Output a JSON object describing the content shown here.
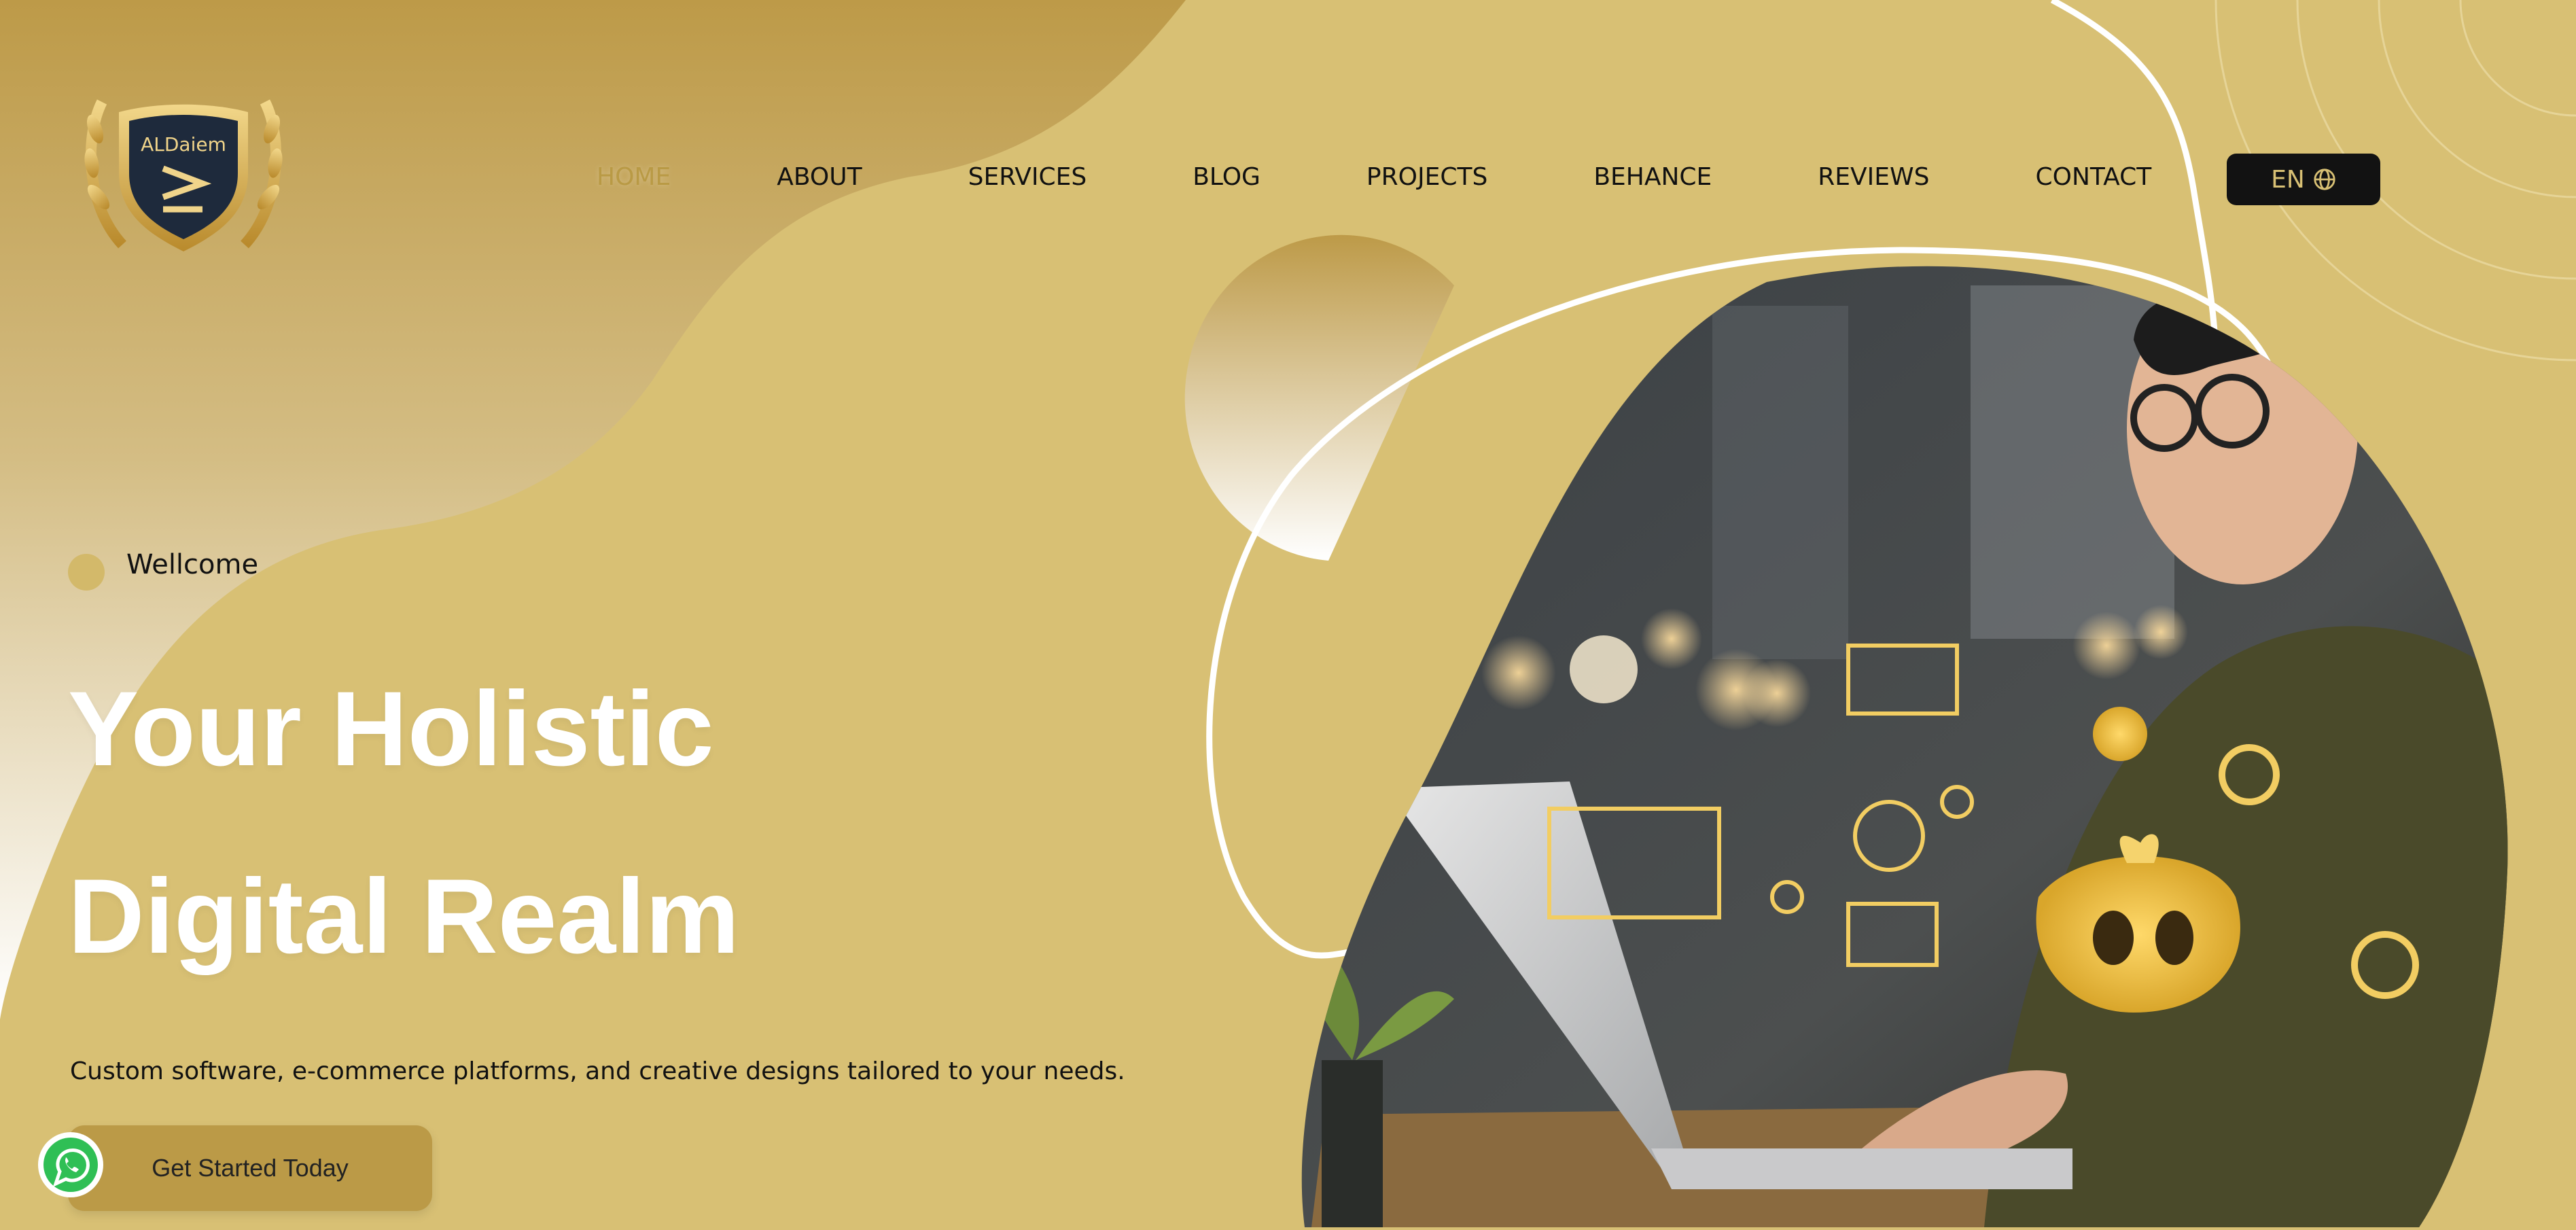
{
  "colors": {
    "background": "#d8c074",
    "accent_dark": "#bb9a47",
    "active_nav": "#b99a45",
    "button_dark": "#121212"
  },
  "logo": {
    "text": "ALDaiem",
    "icon": "shield-logo"
  },
  "nav": {
    "items": [
      {
        "label": "HOME",
        "active": true
      },
      {
        "label": "ABOUT"
      },
      {
        "label": "SERVICES"
      },
      {
        "label": "BLOG"
      },
      {
        "label": "PROJECTS"
      },
      {
        "label": "BEHANCE"
      },
      {
        "label": "REVIEWS"
      },
      {
        "label": "CONTACT"
      }
    ],
    "language": "EN"
  },
  "hero": {
    "welcome": "Wellcome",
    "headline_line1": "Your Holistic",
    "headline_line2": "Digital Realm",
    "subtext": "Custom software, e-commerce platforms, and creative designs tailored to your needs.",
    "cta_label": "Get Started Today",
    "image_icon": "person-laptop-illustration"
  },
  "floating": {
    "whatsapp_icon": "whatsapp-icon"
  }
}
